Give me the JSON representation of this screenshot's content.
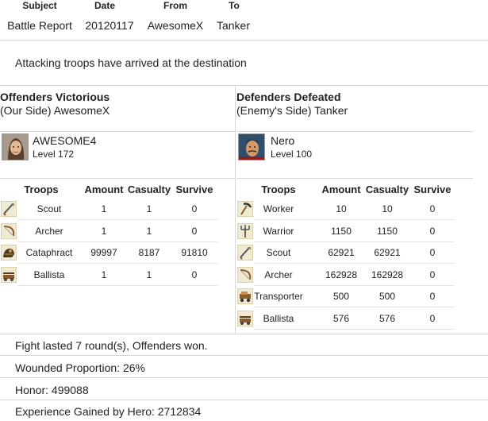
{
  "header": {
    "labels": [
      "Subject",
      "Date",
      "From",
      "To"
    ],
    "values": [
      "Battle Report",
      "20120117",
      "AwesomeX",
      "Tanker"
    ]
  },
  "message": "Attacking troops have arrived at the destination",
  "offender": {
    "title": "Offenders Victorious",
    "subtitle": "(Our Side) AwesomeX",
    "hero_name": "AWESOME4",
    "hero_level": "Level 172",
    "columns": [
      "Troops",
      "Amount",
      "Casualty",
      "Survive"
    ],
    "rows": [
      {
        "icon": "scout-icon",
        "name": "Scout",
        "amount": "1",
        "casualty": "1",
        "survive": "0"
      },
      {
        "icon": "archer-icon",
        "name": "Archer",
        "amount": "1",
        "casualty": "1",
        "survive": "0"
      },
      {
        "icon": "cataphract-icon",
        "name": "Cataphract",
        "amount": "99997",
        "casualty": "8187",
        "survive": "91810"
      },
      {
        "icon": "ballista-icon",
        "name": "Ballista",
        "amount": "1",
        "casualty": "1",
        "survive": "0"
      }
    ]
  },
  "defender": {
    "title": "Defenders Defeated",
    "subtitle": "(Enemy's Side) Tanker",
    "hero_name": "Nero",
    "hero_level": "Level 100",
    "columns": [
      "Troops",
      "Amount",
      "Casualty",
      "Survive"
    ],
    "rows": [
      {
        "icon": "worker-icon",
        "name": "Worker",
        "amount": "10",
        "casualty": "10",
        "survive": "0"
      },
      {
        "icon": "warrior-icon",
        "name": "Warrior",
        "amount": "1150",
        "casualty": "1150",
        "survive": "0"
      },
      {
        "icon": "scout-icon",
        "name": "Scout",
        "amount": "62921",
        "casualty": "62921",
        "survive": "0"
      },
      {
        "icon": "archer-icon",
        "name": "Archer",
        "amount": "162928",
        "casualty": "162928",
        "survive": "0"
      },
      {
        "icon": "transporter-icon",
        "name": "Transporter",
        "amount": "500",
        "casualty": "500",
        "survive": "0"
      },
      {
        "icon": "ballista-icon",
        "name": "Ballista",
        "amount": "576",
        "casualty": "576",
        "survive": "0"
      }
    ]
  },
  "summary": {
    "fight": "Fight lasted 7 round(s), Offenders won.",
    "wounded": "Wounded Proportion: 26%",
    "honor": "Honor: 499088",
    "experience": "Experience Gained by Hero: 2712834"
  }
}
